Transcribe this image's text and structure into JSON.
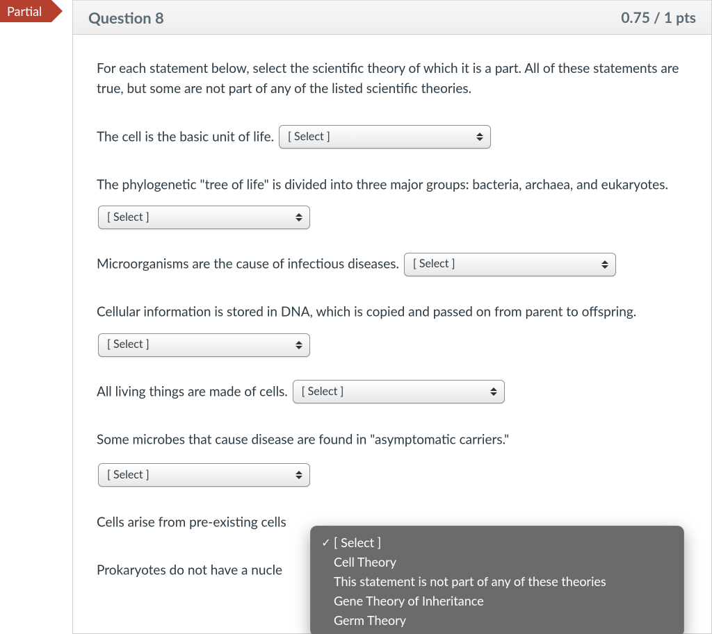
{
  "ribbon": {
    "label": "Partial"
  },
  "header": {
    "title": "Question 8",
    "points": "0.75 / 1 pts"
  },
  "intro": "For each statement below, select the scientific theory of which it is a part. All of these statements are true, but some are not part of any of the listed scientific theories.",
  "select_placeholder": "[ Select ]",
  "statements": [
    {
      "text": "The cell is the basic unit of life."
    },
    {
      "text_a": "The phylogenetic \"tree of life\" is divided into three major groups: bacteria, archaea, and ",
      "text_b": "eukaryotes."
    },
    {
      "text": "Microorganisms are the cause of infectious diseases."
    },
    {
      "text_a": "Cellular information is stored in DNA, which is copied and passed on from parent to ",
      "text_b": "offspring."
    },
    {
      "text": "All living things are made of cells."
    },
    {
      "text": "Some microbes that cause disease are found in \"asymptomatic carriers.\""
    },
    {
      "text": "Cells arise from pre-existing cells"
    },
    {
      "text": "Prokaryotes do not have a nucle"
    }
  ],
  "dropdown": {
    "open_for_index": 6,
    "options": [
      {
        "label": "[ Select ]",
        "checked": true
      },
      {
        "label": "Cell Theory",
        "checked": false
      },
      {
        "label": "This statement is not part of any of these theories",
        "checked": false
      },
      {
        "label": "Gene Theory of Inheritance",
        "checked": false
      },
      {
        "label": "Germ Theory",
        "checked": false
      }
    ]
  }
}
